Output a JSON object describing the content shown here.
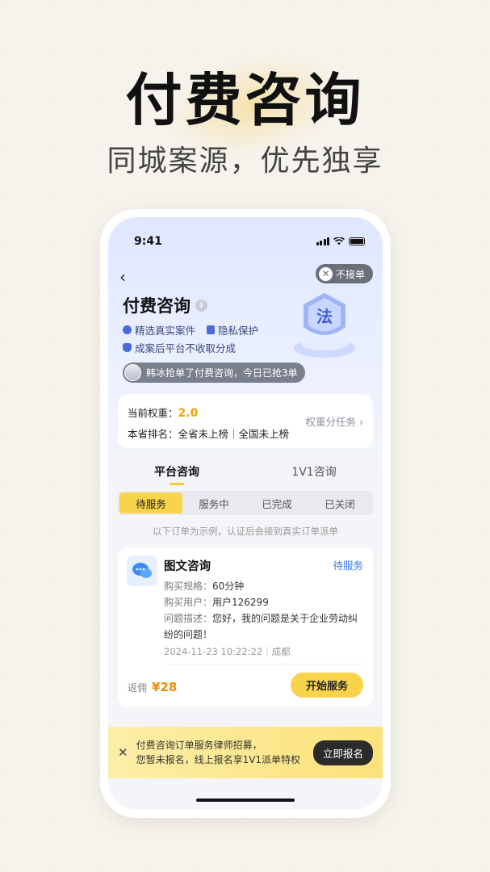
{
  "hero": {
    "title": "付费咨询",
    "subtitle": "同城案源，优先独享"
  },
  "status_bar": {
    "time": "9:41"
  },
  "header": {
    "back_icon": "‹",
    "toggle_label": "不接单",
    "title": "付费咨询"
  },
  "features": [
    "精选真实案件",
    "隐私保护",
    "成案后平台不收取分成"
  ],
  "grab_notice": "韩冰抢单了付费咨询，今日已抢3单",
  "weight": {
    "label": "当前权重：",
    "value": "2.0",
    "rank_label": "本省排名：",
    "rank_value": "全省未上榜｜全国未上榜",
    "task_link": "权重分任务 ›"
  },
  "tabs": [
    "平台咨询",
    "1V1咨询"
  ],
  "filters": [
    "待服务",
    "服务中",
    "已完成",
    "已关闭"
  ],
  "notice": "以下订单为示例，认证后会接到真实订单派单",
  "order": {
    "type": "图文咨询",
    "status": "待服务",
    "spec_label": "购买规格：",
    "spec": "60分钟",
    "user_label": "购买用户：",
    "user": "用户126299",
    "desc_label": "问题描述：",
    "desc": "您好，我的问题是关于企业劳动纠纷的问题！",
    "time": "2024-11-23 10:22:22｜成都",
    "fee_label": "返佣",
    "fee": "¥28",
    "button": "开始服务"
  },
  "banner": {
    "line1": "付费咨询订单服务律师招募，",
    "line2": "您暂未报名，线上报名享1V1派单特权",
    "cta": "立即报名"
  },
  "colors": {
    "accent": "#f8d44a",
    "link": "#3a77e8",
    "money": "#f08c00"
  }
}
